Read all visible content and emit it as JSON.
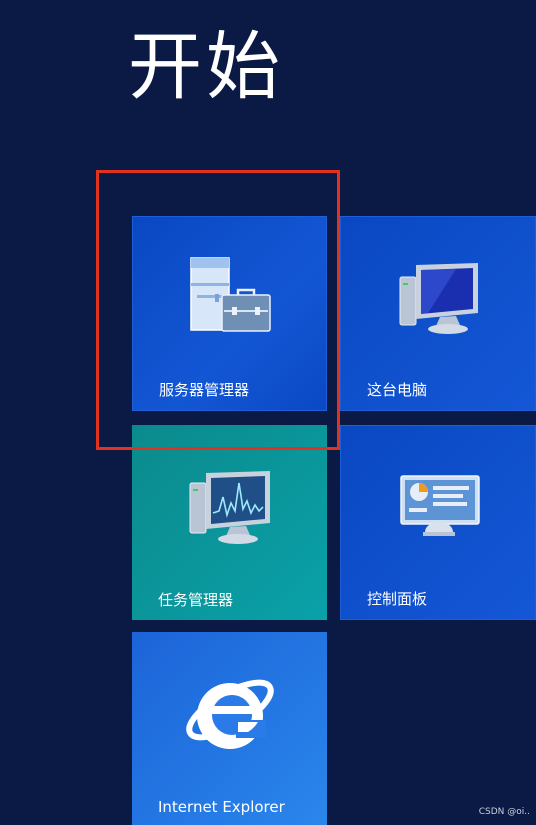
{
  "start_title": "开始",
  "tiles": [
    {
      "label": "服务器管理器",
      "icon": "server-manager-icon"
    },
    {
      "label": "这台电脑",
      "icon": "computer-icon"
    },
    {
      "label": "任务管理器",
      "icon": "task-manager-icon"
    },
    {
      "label": "控制面板",
      "icon": "control-panel-icon"
    },
    {
      "label": "Internet Explorer",
      "icon": "internet-explorer-icon"
    }
  ],
  "highlight_color": "#e2321f",
  "watermark": "CSDN @oi.."
}
